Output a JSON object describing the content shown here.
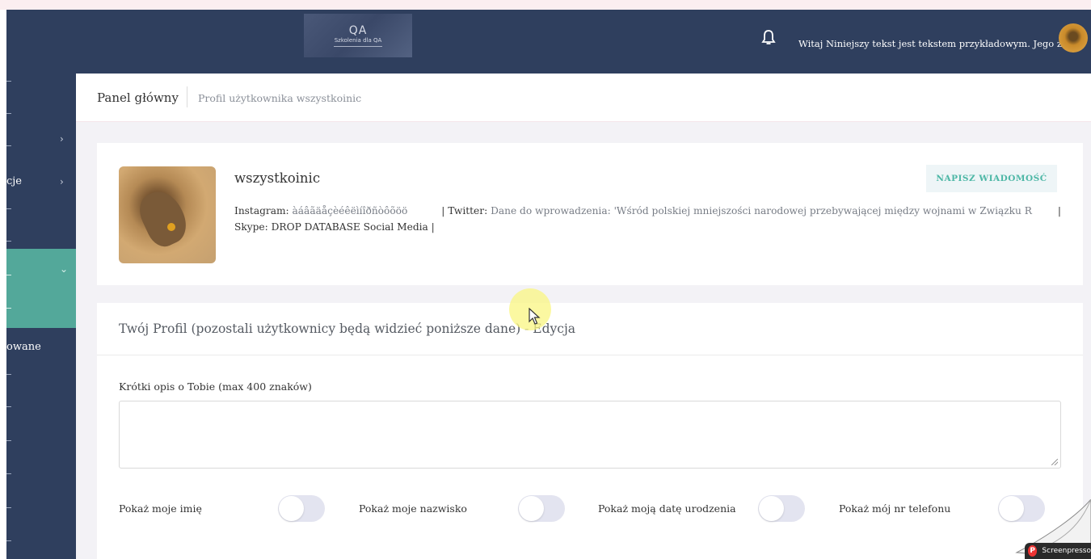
{
  "header": {
    "logo_big": "QA",
    "logo_small": "Szkolenia dla QA",
    "greeting": "Witaj Niniejszy tekst jest tekstem przykładowym. Jego za"
  },
  "sidebar": {
    "items": [
      {
        "label": ""
      },
      {
        "label": "cje"
      },
      {
        "label": ""
      },
      {
        "label": "owane"
      }
    ]
  },
  "breadcrumb": {
    "main": "Panel główny",
    "sub": "Profil użytkownika wszystkoinic"
  },
  "profile": {
    "username": "wszystkoinic",
    "message_button": "NAPISZ WIADOMOŚĆ",
    "instagram_label": "Instagram:",
    "instagram_value": "àáâãäåçèéêëìíîðñòôõöö",
    "twitter_label": "Twitter:",
    "twitter_value": "Dane do wprowadzenia: 'Wśród polskiej mniejszości narodowej przebywającej między wojnami w Związku R",
    "skype_label": "Skype:",
    "skype_value": "DROP DATABASE Social Media"
  },
  "edit": {
    "title": "Twój Profil (pozostali użytkownicy będą widzieć poniższe dane) - Edycja",
    "bio_label": "Krótki opis o Tobie (max 400 znaków)",
    "bio_value": "",
    "toggles": [
      {
        "label": "Pokaż moje imię",
        "on": false
      },
      {
        "label": "Pokaż moje nazwisko",
        "on": false
      },
      {
        "label": "Pokaż moją datę urodzenia",
        "on": false
      },
      {
        "label": "Pokaż mój nr telefonu",
        "on": false
      }
    ]
  },
  "watermark": {
    "brand": "Screenpresso"
  },
  "colors": {
    "nav": "#2f3f5e",
    "accent": "#53a89a",
    "button_text": "#4db7a6"
  }
}
